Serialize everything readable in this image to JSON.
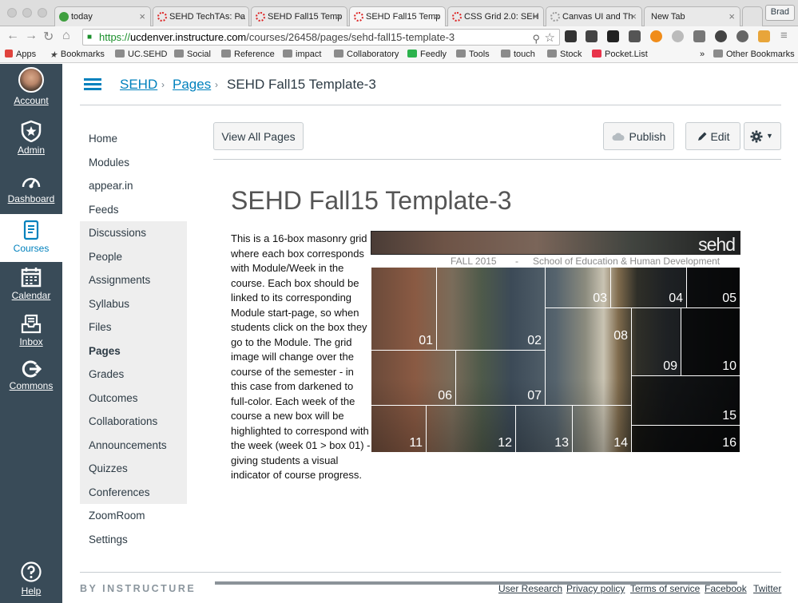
{
  "browser": {
    "tabs": [
      {
        "label": "today",
        "fav": "#3f9f3f",
        "active": false
      },
      {
        "label": "SEHD TechTAs: Pa",
        "fav": "#d22",
        "active": false
      },
      {
        "label": "SEHD Fall15 Temp",
        "fav": "#d22",
        "active": false
      },
      {
        "label": "SEHD Fall15 Temp",
        "fav": "#d22",
        "active": true
      },
      {
        "label": "CSS Grid 2.0: SEH",
        "fav": "#d22",
        "active": false
      },
      {
        "label": "Canvas UI and Th",
        "fav": "#999",
        "active": false
      },
      {
        "label": "New Tab",
        "fav": "",
        "active": false
      }
    ],
    "profile": "Brad",
    "url": {
      "scheme": "https://",
      "host": "ucdenver.instructure.com",
      "path": "/courses/26458/pages/sehd-fall15-template-3"
    },
    "bookmarks": [
      "Apps",
      "Bookmarks",
      "UC.SEHD",
      "Social",
      "Reference",
      "impact",
      "Collaboratory",
      "Feedly",
      "Tools",
      "touch",
      "Stock",
      "Pocket.List"
    ],
    "more": "»",
    "other_bookmarks": "Other Bookmarks"
  },
  "global_nav": [
    {
      "label": "Account",
      "icon": "avatar-icon"
    },
    {
      "label": "Admin",
      "icon": "shield-star-icon"
    },
    {
      "label": "Dashboard",
      "icon": "gauge-icon"
    },
    {
      "label": "Courses",
      "icon": "book-icon"
    },
    {
      "label": "Calendar",
      "icon": "calendar-icon"
    },
    {
      "label": "Inbox",
      "icon": "inbox-icon"
    },
    {
      "label": "Commons",
      "icon": "commons-arrow-icon"
    },
    {
      "label": "Help",
      "icon": "help-icon"
    }
  ],
  "breadcrumbs": {
    "course": "SEHD",
    "section": "Pages",
    "current": "SEHD Fall15 Template-3",
    "sep": "›"
  },
  "course_nav": [
    "Home",
    "Modules",
    "appear.in",
    "Feeds",
    "Discussions",
    "People",
    "Assignments",
    "Syllabus",
    "Files",
    "Pages",
    "Grades",
    "Outcomes",
    "Collaborations",
    "Announcements",
    "Quizzes",
    "Conferences",
    "ZoomRoom",
    "Settings"
  ],
  "course_nav_hidden": [
    4,
    5,
    6,
    7,
    8,
    9,
    10,
    11,
    12,
    13,
    14,
    15
  ],
  "course_nav_current": 9,
  "actions": {
    "view_all": "View All Pages",
    "publish": "Publish",
    "edit": "Edit"
  },
  "page": {
    "title": "SEHD Fall15 Template-3",
    "body": "This is a 16-box masonry grid where each box corresponds with Module/Week in the course. Each box should be linked to its corresponding Module start-page, so when students click on the box they go to the Module. The grid image will change over the course of the semester - in this case from darkened to full-color. Each week of the course a new box will be highlighted to correspond with the week (week 01 > box 01) - giving students a visual indicator of course progress.",
    "banner_logo": "sehd",
    "banner_term": "FALL 2015",
    "banner_dash": "-",
    "banner_school": "School of Education & Human Development",
    "boxes": [
      "01",
      "02",
      "03",
      "04",
      "05",
      "06",
      "07",
      "08",
      "09",
      "10",
      "11",
      "12",
      "13",
      "14",
      "15",
      "16"
    ]
  },
  "footer": {
    "brand": "BY INSTRUCTURE",
    "links": [
      "User Research",
      "Privacy policy",
      "Terms of service",
      "Facebook",
      "Twitter"
    ]
  }
}
